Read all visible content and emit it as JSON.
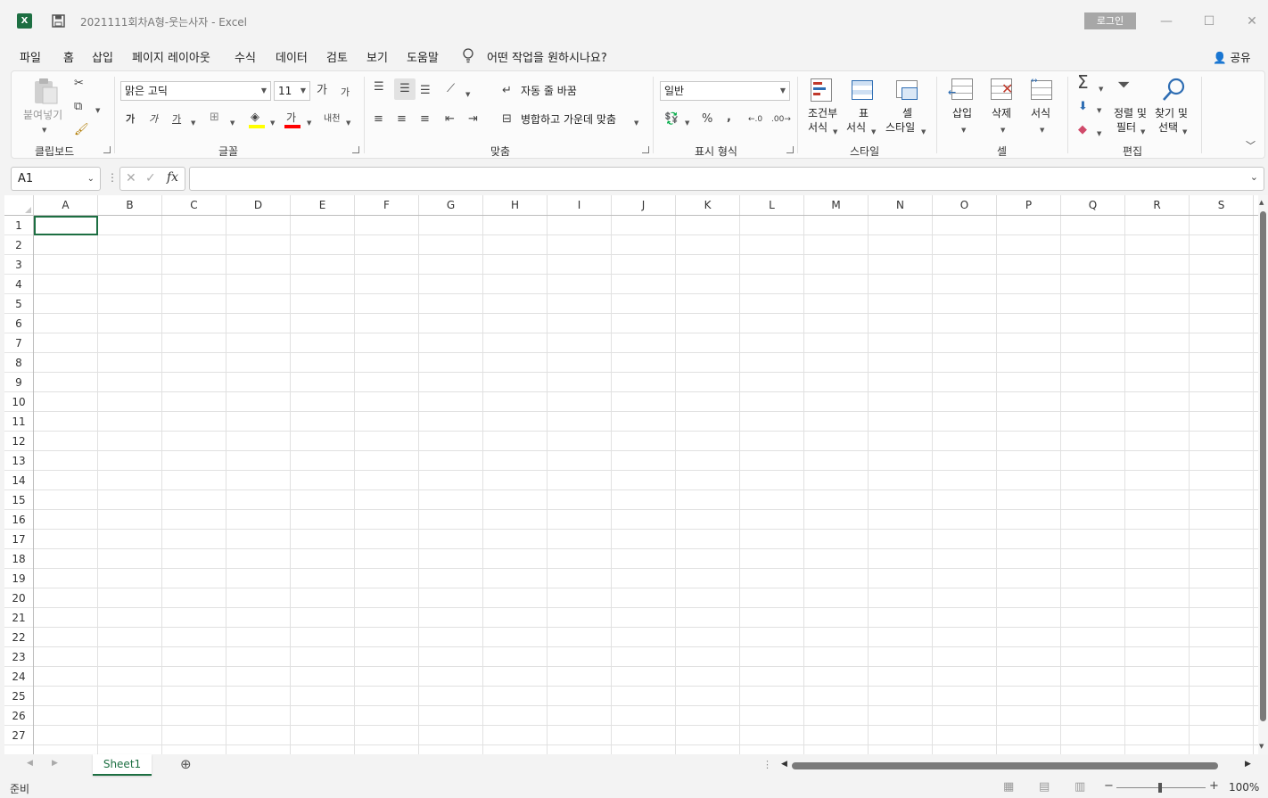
{
  "window": {
    "app_icon_letter": "X",
    "title": "2021111회차A형-웃는사자  -  Excel",
    "login_label": "로그인",
    "minimize": "—",
    "maximize": "☐",
    "close": "✕"
  },
  "menu": {
    "tabs": [
      "파일",
      "홈",
      "삽입",
      "페이지 레이아웃",
      "수식",
      "데이터",
      "검토",
      "보기",
      "도움말"
    ],
    "tell_me": "어떤 작업을 원하시나요?",
    "share": "공유"
  },
  "ribbon": {
    "clipboard": {
      "paste": "붙여넣기",
      "label": "클립보드"
    },
    "font": {
      "name": "맑은 고딕",
      "size": "11",
      "grow": "가",
      "shrink": "가",
      "bold": "가",
      "italic": "가",
      "underline": "가",
      "font_color_glyph": "가",
      "phonetic": "내천",
      "label": "글꼴"
    },
    "alignment": {
      "wrap": "자동 줄 바꿈",
      "merge": "병합하고 가운데 맞춤",
      "label": "맞춤"
    },
    "number": {
      "format": "일반",
      "percent": "%",
      "comma": ",",
      "label": "표시 형식"
    },
    "styles": {
      "conditional": [
        "조건부",
        "서식"
      ],
      "table": [
        "표",
        "서식"
      ],
      "cell": [
        "셀",
        "스타일"
      ],
      "label": "스타일"
    },
    "cells": {
      "insert": "삽입",
      "delete": "삭제",
      "format": "서식",
      "label": "셀"
    },
    "editing": {
      "sort": [
        "정렬 및",
        "필터"
      ],
      "find": [
        "찾기 및",
        "선택"
      ],
      "label": "편집"
    }
  },
  "formula_bar": {
    "name_box": "A1",
    "fx": "fx",
    "value": ""
  },
  "grid": {
    "columns": [
      "A",
      "B",
      "C",
      "D",
      "E",
      "F",
      "G",
      "H",
      "I",
      "J",
      "K",
      "L",
      "M",
      "N",
      "O",
      "P",
      "Q",
      "R",
      "S"
    ],
    "rows": [
      "1",
      "2",
      "3",
      "4",
      "5",
      "6",
      "7",
      "8",
      "9",
      "10",
      "11",
      "12",
      "13",
      "14",
      "15",
      "16",
      "17",
      "18",
      "19",
      "20",
      "21",
      "22",
      "23",
      "24",
      "25",
      "26",
      "27"
    ]
  },
  "sheets": {
    "tabs": [
      "Sheet1"
    ],
    "add": "⊕"
  },
  "status": {
    "ready": "준비",
    "zoom": "100%"
  },
  "colors": {
    "accent": "#1d6f42",
    "highlight": "#ffff00",
    "font_red": "#ff0000"
  }
}
